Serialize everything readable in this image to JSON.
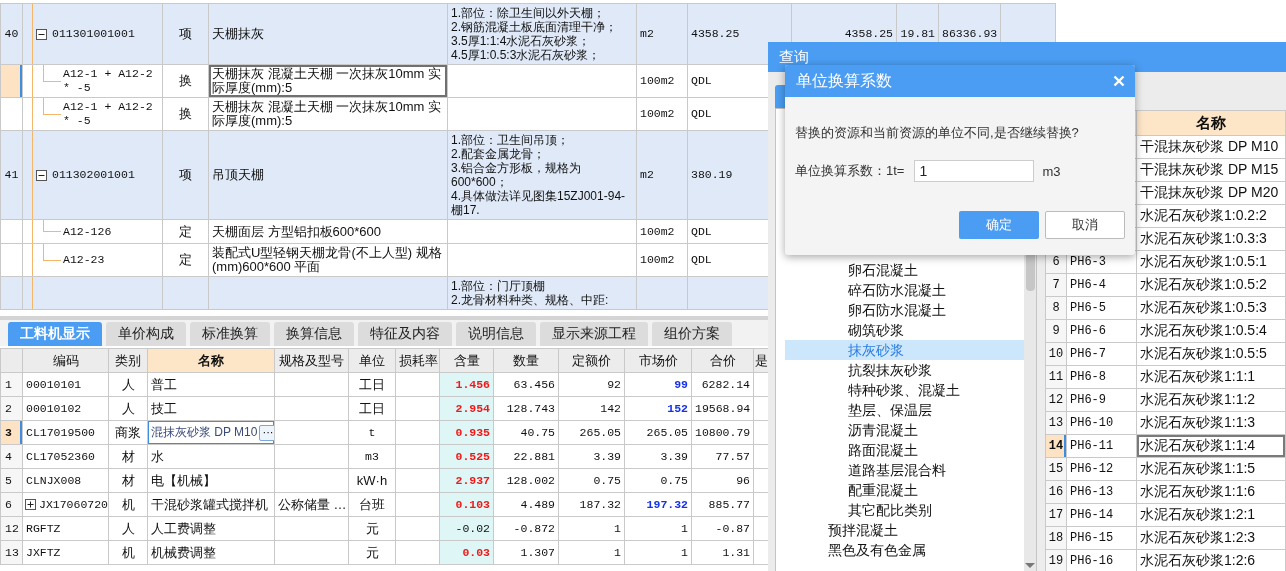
{
  "bill_table": {
    "rows": [
      {
        "kind": "item",
        "selected": false,
        "row_number": "40",
        "expanded": true,
        "code": "011301001001",
        "type": "项",
        "name": "天棚抹灰",
        "features": "1.部位：除卫生间以外天棚；\n2.钢筋混凝土板底面清理干净；\n3.5厚1:1:4水泥石灰砂浆；\n4.5厚1:0.5:3水泥石灰砂浆；",
        "unit": "m2",
        "quantity_expression": "4358.25",
        "quantity": "4358.25",
        "unit_price": "19.81",
        "total": "86336.93"
      },
      {
        "kind": "quota",
        "selected": true,
        "code": "A12-1 + A12-2 * -5",
        "type": "换",
        "name": "天棚抹灰 混凝土天棚 一次抹灰10mm  实际厚度(mm):5",
        "unit": "100m2",
        "quantity_expression": "QDL"
      },
      {
        "kind": "quota",
        "selected": false,
        "code": "A12-1 + A12-2 * -5",
        "type": "换",
        "name": "天棚抹灰 混凝土天棚 一次抹灰10mm  实际厚度(mm):5",
        "unit": "100m2",
        "quantity_expression": "QDL"
      },
      {
        "kind": "item",
        "selected": false,
        "row_number": "41",
        "expanded": true,
        "code": "011302001001",
        "type": "项",
        "name": "吊顶天棚",
        "features": "1.部位：卫生间吊顶；\n2.配套金属龙骨；\n3.铝合金方形板，规格为600*600；\n4.具体做法详见图集15ZJ001-94-棚17.",
        "unit": "m2",
        "quantity_expression": "380.19"
      },
      {
        "kind": "quota",
        "selected": false,
        "code": "A12-126",
        "type": "定",
        "name": "天棚面层 方型铝扣板600*600",
        "unit": "100m2",
        "quantity_expression": "QDL"
      },
      {
        "kind": "quota",
        "selected": false,
        "code": "A12-23",
        "type": "定",
        "name": "装配式U型轻钢天棚龙骨(不上人型) 规格(mm)600*600 平面",
        "unit": "100m2",
        "quantity_expression": "QDL"
      },
      {
        "kind": "item",
        "selected": false,
        "features": "1.部位：门厅顶棚\n2.龙骨材料种类、规格、中距:"
      }
    ]
  },
  "detail_tabs": [
    {
      "label": "工料机显示",
      "selected": true
    },
    {
      "label": "单价构成",
      "selected": false
    },
    {
      "label": "标准换算",
      "selected": false
    },
    {
      "label": "换算信息",
      "selected": false
    },
    {
      "label": "特征及内容",
      "selected": false
    },
    {
      "label": "说明信息",
      "selected": false
    },
    {
      "label": "显示来源工程",
      "selected": false
    },
    {
      "label": "组价方案",
      "selected": false
    }
  ],
  "resource_table": {
    "columns": [
      {
        "label": "编码",
        "selected": false
      },
      {
        "label": "类别",
        "selected": false
      },
      {
        "label": "名称",
        "selected": true
      },
      {
        "label": "规格及型号",
        "selected": false
      },
      {
        "label": "单位",
        "selected": false
      },
      {
        "label": "损耗率",
        "selected": false
      },
      {
        "label": "含量",
        "selected": false
      },
      {
        "label": "数量",
        "selected": false
      },
      {
        "label": "定额价",
        "selected": false
      },
      {
        "label": "市场价",
        "selected": false
      },
      {
        "label": "合价",
        "selected": false
      },
      {
        "label": "是",
        "selected": false
      }
    ],
    "rows": [
      {
        "row_number": "1",
        "selected": false,
        "code": "00010101",
        "type": "人",
        "name": "普工",
        "unit": "工日",
        "content": "1.456",
        "content_changed": true,
        "quantity": "63.456",
        "base_price": "92",
        "market_price": "99",
        "price_changed": true,
        "total": "6282.14"
      },
      {
        "row_number": "2",
        "selected": false,
        "code": "00010102",
        "type": "人",
        "name": "技工",
        "unit": "工日",
        "content": "2.954",
        "content_changed": true,
        "quantity": "128.743",
        "base_price": "142",
        "market_price": "152",
        "price_changed": true,
        "total": "19568.94"
      },
      {
        "row_number": "3",
        "selected": true,
        "code": "CL17019500",
        "type": "商浆",
        "name": "混抹灰砂浆 DP M10",
        "edit_button": "···",
        "unit": "t",
        "content": "0.935",
        "content_changed": true,
        "quantity": "40.75",
        "base_price": "265.05",
        "market_price": "265.05",
        "price_changed": false,
        "total": "10800.79"
      },
      {
        "row_number": "4",
        "selected": false,
        "code": "CL17052360",
        "type": "材",
        "name": "水",
        "unit": "m3",
        "content": "0.525",
        "content_changed": true,
        "quantity": "22.881",
        "base_price": "3.39",
        "market_price": "3.39",
        "price_changed": false,
        "total": "77.57"
      },
      {
        "row_number": "5",
        "selected": false,
        "code": "CLNJX008",
        "type": "材",
        "name": "电【机械】",
        "unit": "kW·h",
        "content": "2.937",
        "content_changed": true,
        "quantity": "128.002",
        "base_price": "0.75",
        "market_price": "0.75",
        "price_changed": false,
        "total": "96"
      },
      {
        "row_number": "6",
        "selected": false,
        "expanded": false,
        "code": "JX17060720",
        "type": "机",
        "name": "干混砂浆罐式搅拌机",
        "spec": "公称储量 …",
        "unit": "台班",
        "content": "0.103",
        "content_changed": true,
        "quantity": "4.489",
        "base_price": "187.32",
        "market_price": "197.32",
        "price_changed": true,
        "total": "885.77"
      },
      {
        "row_number": "12",
        "selected": false,
        "code": "RGFTZ",
        "type": "人",
        "name": "人工费调整",
        "unit": "元",
        "content": "-0.02",
        "content_changed": false,
        "quantity": "-0.872",
        "base_price": "1",
        "market_price": "1",
        "price_changed": false,
        "total": "-0.87"
      },
      {
        "row_number": "13",
        "selected": false,
        "code": "JXFTZ",
        "type": "机",
        "name": "机械费调整",
        "unit": "元",
        "content": "0.03",
        "content_changed": true,
        "quantity": "1.307",
        "base_price": "1",
        "market_price": "1",
        "price_changed": false,
        "total": "1.31"
      }
    ]
  },
  "query_window": {
    "title": "查询",
    "tree": {
      "items": [
        {
          "children": [
            {
              "label": "卵石混凝土",
              "selected": false
            },
            {
              "label": "碎石防水混凝土",
              "selected": false
            },
            {
              "label": "卵石防水混凝土",
              "selected": false
            },
            {
              "label": "砌筑砂浆",
              "selected": false
            },
            {
              "label": "抹灰砂浆",
              "selected": true
            },
            {
              "label": "抗裂抹灰砂浆",
              "selected": false
            },
            {
              "label": "特种砂浆、混凝土",
              "selected": false
            },
            {
              "label": "垫层、保温层",
              "selected": false
            },
            {
              "label": "沥青混凝土",
              "selected": false
            },
            {
              "label": "路面混凝土",
              "selected": false
            },
            {
              "label": "道路基层混合料",
              "selected": false
            },
            {
              "label": "配重混凝土",
              "selected": false
            },
            {
              "label": "其它配比类别",
              "selected": false
            }
          ]
        },
        {
          "label": "预拌混凝土",
          "selected": false
        },
        {
          "label": "黑色及有色金属",
          "selected": false
        }
      ]
    },
    "table": {
      "name_header": "名称",
      "rows": [
        {
          "selected": false,
          "name": "干混抹灰砂浆 DP M10"
        },
        {
          "selected": false,
          "name": "干混抹灰砂浆 DP M15"
        },
        {
          "selected": false,
          "name": "干混抹灰砂浆 DP M20"
        },
        {
          "selected": false,
          "name": "水泥石灰砂浆1:0.2:2"
        },
        {
          "selected": false,
          "name": "水泥石灰砂浆1:0.3:3"
        },
        {
          "selected": false,
          "row_number": "6",
          "code": "PH6-3",
          "name": "水泥石灰砂浆1:0.5:1"
        },
        {
          "selected": false,
          "row_number": "7",
          "code": "PH6-4",
          "name": "水泥石灰砂浆1:0.5:2"
        },
        {
          "selected": false,
          "row_number": "8",
          "code": "PH6-5",
          "name": "水泥石灰砂浆1:0.5:3"
        },
        {
          "selected": false,
          "row_number": "9",
          "code": "PH6-6",
          "name": "水泥石灰砂浆1:0.5:4"
        },
        {
          "selected": false,
          "row_number": "10",
          "code": "PH6-7",
          "name": "水泥石灰砂浆1:0.5:5"
        },
        {
          "selected": false,
          "row_number": "11",
          "code": "PH6-8",
          "name": "水泥石灰砂浆1:1:1"
        },
        {
          "selected": false,
          "row_number": "12",
          "code": "PH6-9",
          "name": "水泥石灰砂浆1:1:2"
        },
        {
          "selected": false,
          "row_number": "13",
          "code": "PH6-10",
          "name": "水泥石灰砂浆1:1:3"
        },
        {
          "selected": true,
          "row_number": "14",
          "code": "PH6-11",
          "name": "水泥石灰砂浆1:1:4"
        },
        {
          "selected": false,
          "row_number": "15",
          "code": "PH6-12",
          "name": "水泥石灰砂浆1:1:5"
        },
        {
          "selected": false,
          "row_number": "16",
          "code": "PH6-13",
          "name": "水泥石灰砂浆1:1:6"
        },
        {
          "selected": false,
          "row_number": "17",
          "code": "PH6-14",
          "name": "水泥石灰砂浆1:2:1"
        },
        {
          "selected": false,
          "row_number": "18",
          "code": "PH6-15",
          "name": "水泥石灰砂浆1:2:3"
        },
        {
          "selected": false,
          "row_number": "19",
          "code": "PH6-16",
          "name": "水泥石灰砂浆1:2:6"
        }
      ]
    }
  },
  "unit_dialog": {
    "title": "单位换算系数",
    "message": "替换的资源和当前资源的单位不同,是否继续替换?",
    "factor_label": "单位换算系数：1t=",
    "factor_value": "1",
    "target_unit": "m3",
    "buttons": [
      {
        "label": "确定",
        "kind": "primary"
      },
      {
        "label": "取消",
        "kind": "secondary"
      }
    ]
  }
}
